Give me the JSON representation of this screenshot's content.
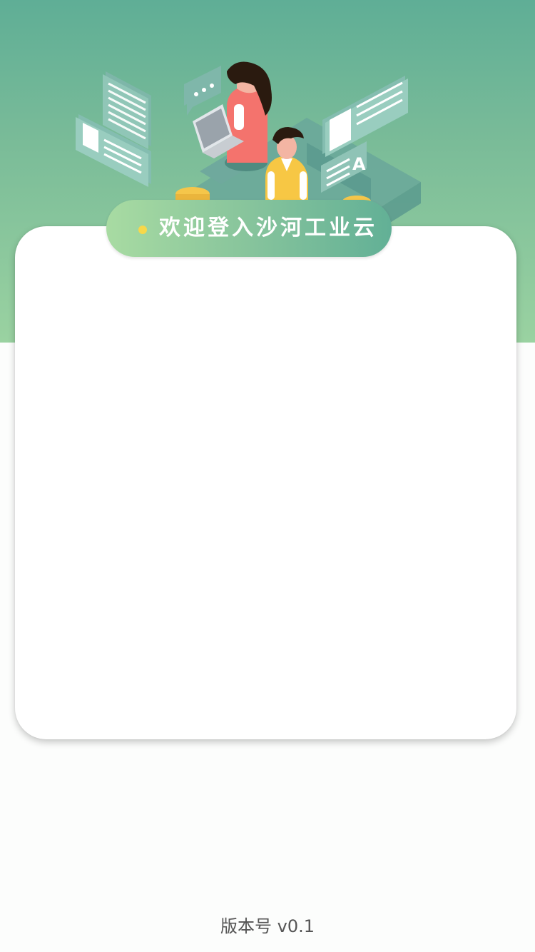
{
  "header": {
    "welcome_text": "欢迎登入沙河工业云"
  },
  "illustration": {
    "icon": "people-working-laptop-illustration",
    "doc_letter": "A"
  },
  "footer": {
    "version_text": "版本号 v0.1"
  },
  "colors": {
    "hero_top": "#5fae96",
    "hero_bottom": "#9ad2a1",
    "pill_left": "#a8dba2",
    "pill_right": "#62b096",
    "dot": "#f7d84a",
    "card": "#ffffff",
    "page_background": "#fcfdfc"
  }
}
